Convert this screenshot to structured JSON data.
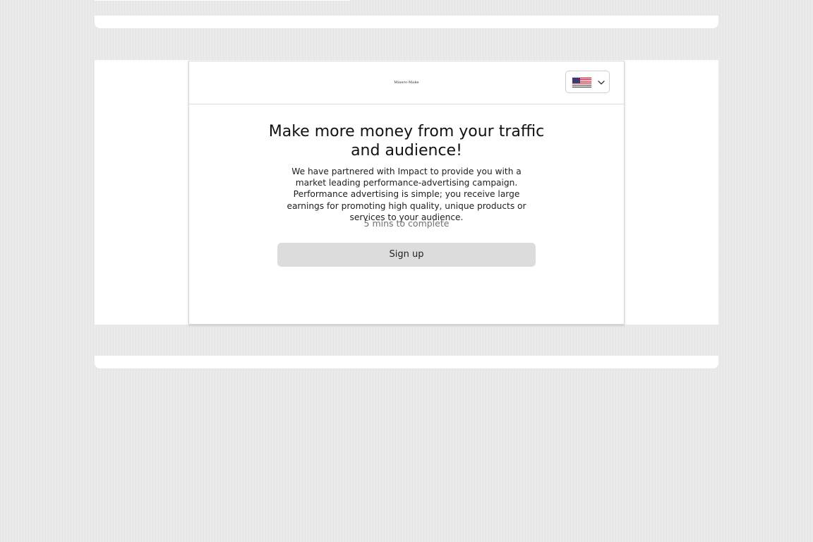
{
  "header": {
    "brand_name": "Mixers-Make",
    "language": {
      "selected": "English (US)",
      "flag_icon": "us-flag-icon",
      "toggle_icon": "chevron-down-icon"
    }
  },
  "content": {
    "headline": "Make more money from your traffic and audience!",
    "description": "We have partnered with Impact to provide you with a market leading performance-advertising campaign. Performance advertising is simple; you receive large earnings for promoting high quality, unique products or services to your audience.",
    "duration": "5 mins to complete",
    "signup_label": "Sign up"
  },
  "colors": {
    "page_background": "#e9e9e9",
    "card_background": "#ffffff",
    "button_background": "#dcdcdc",
    "muted_text": "#707070"
  }
}
